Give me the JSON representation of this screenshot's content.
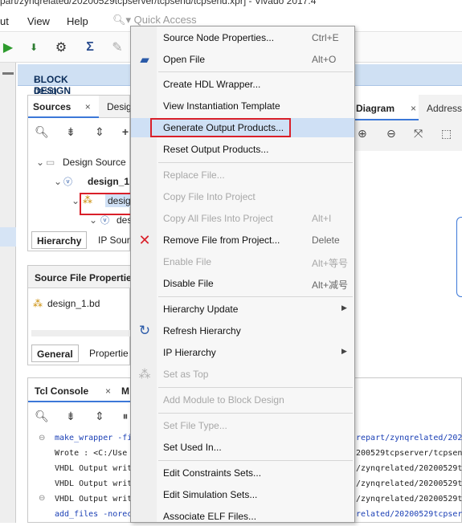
{
  "window_title": "part/zynqrelated/20200529tcpserver/tcpsend/tcpsend.xpr] - Vivado 2017.4",
  "menubar": {
    "items": [
      "ut",
      "View",
      "Help"
    ],
    "quick_access_placeholder": "Quick Access"
  },
  "banner": {
    "title": "BLOCK DESIGN",
    "subtitle": " - desig"
  },
  "sources_panel": {
    "tabs": [
      "Sources",
      "Desig"
    ],
    "tree": {
      "design_sources": "Design Source",
      "design_1": "design_1",
      "design_child": "desig",
      "design_grandchild": "des"
    },
    "bottom_tabs": [
      "Hierarchy",
      "IP Sour"
    ]
  },
  "source_file_properties": {
    "title": "Source File Propertie",
    "file": "design_1.bd",
    "bottom_tabs": [
      "General",
      "Propertie"
    ]
  },
  "right_panel": {
    "tabs": [
      "Diagram",
      "Address"
    ]
  },
  "tcl_console": {
    "tabs": [
      "Tcl Console",
      "M"
    ],
    "left_lines": [
      "make_wrapper -fi",
      "Wrote  : <C:/Use",
      "VHDL Output writ",
      "VHDL Output writ",
      "VHDL Output writ",
      "add_files -norec"
    ],
    "right_lines": [
      "repart/zynqrelated/2020",
      "200529tcpserver/tcpsen",
      "/zynqrelated/20200529tc",
      "/zynqrelated/20200529tc",
      "/zynqrelated/20200529tc",
      "related/20200529tcpser"
    ]
  },
  "context_menu": {
    "items": [
      {
        "label": "Source Node Properties...",
        "shortcut": "Ctrl+E",
        "enabled": true,
        "icon": ""
      },
      {
        "label": "Open File",
        "shortcut": "Alt+O",
        "enabled": true,
        "icon": "folder-icon"
      },
      {
        "label": "Create HDL Wrapper...",
        "shortcut": "",
        "enabled": true,
        "icon": ""
      },
      {
        "label": "View Instantiation Template",
        "shortcut": "",
        "enabled": true,
        "icon": ""
      },
      {
        "label": "Generate Output Products...",
        "shortcut": "",
        "enabled": true,
        "icon": ""
      },
      {
        "label": "Reset Output Products...",
        "shortcut": "",
        "enabled": true,
        "icon": ""
      },
      {
        "label": "Replace File...",
        "shortcut": "",
        "enabled": false,
        "icon": ""
      },
      {
        "label": "Copy File Into Project",
        "shortcut": "",
        "enabled": false,
        "icon": ""
      },
      {
        "label": "Copy All Files Into Project",
        "shortcut": "Alt+I",
        "enabled": false,
        "icon": ""
      },
      {
        "label": "Remove File from Project...",
        "shortcut": "Delete",
        "enabled": true,
        "icon": "remove-x-icon"
      },
      {
        "label": "Enable File",
        "shortcut": "Alt+等号",
        "enabled": false,
        "icon": ""
      },
      {
        "label": "Disable File",
        "shortcut": "Alt+减号",
        "enabled": true,
        "icon": ""
      },
      {
        "label": "Hierarchy Update",
        "shortcut": "",
        "enabled": true,
        "icon": ""
      },
      {
        "label": "Refresh Hierarchy",
        "shortcut": "",
        "enabled": true,
        "icon": "refresh-icon"
      },
      {
        "label": "IP Hierarchy",
        "shortcut": "",
        "enabled": true,
        "icon": ""
      },
      {
        "label": "Set as Top",
        "shortcut": "",
        "enabled": false,
        "icon": "hierarchy-icon"
      },
      {
        "label": "Add Module to Block Design",
        "shortcut": "",
        "enabled": false,
        "icon": ""
      },
      {
        "label": "Set File Type...",
        "shortcut": "",
        "enabled": false,
        "icon": ""
      },
      {
        "label": "Set Used In...",
        "shortcut": "",
        "enabled": true,
        "icon": ""
      },
      {
        "label": "Edit Constraints Sets...",
        "shortcut": "",
        "enabled": true,
        "icon": ""
      },
      {
        "label": "Edit Simulation Sets...",
        "shortcut": "",
        "enabled": true,
        "icon": ""
      },
      {
        "label": "Associate ELF Files...",
        "shortcut": "",
        "enabled": true,
        "icon": ""
      }
    ]
  },
  "colors": {
    "highlight": "#cfe0f5",
    "annotation_red": "#d9202a",
    "banner": "#cfe0f3"
  }
}
